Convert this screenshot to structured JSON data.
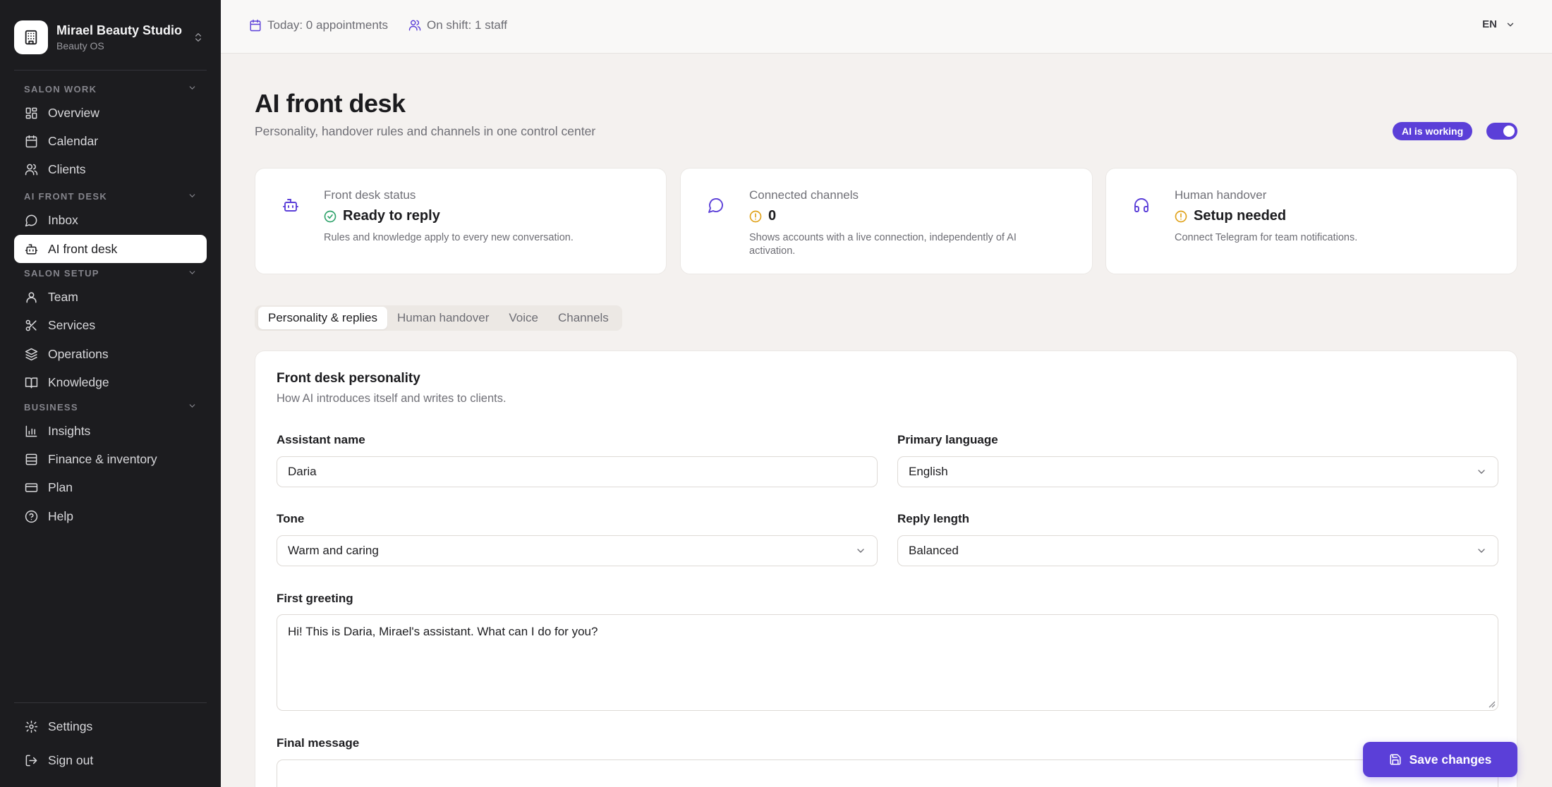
{
  "brand": {
    "name": "Mirael Beauty Studio",
    "subtitle": "Beauty OS"
  },
  "sidebar": {
    "sections": [
      {
        "title": "SALON WORK",
        "items": [
          {
            "label": "Overview",
            "icon": "grid-icon"
          },
          {
            "label": "Calendar",
            "icon": "calendar-icon"
          },
          {
            "label": "Clients",
            "icon": "users-icon"
          }
        ]
      },
      {
        "title": "AI FRONT DESK",
        "items": [
          {
            "label": "Inbox",
            "icon": "chat-bubble-icon"
          },
          {
            "label": "AI front desk",
            "icon": "robot-icon",
            "active": true
          }
        ]
      },
      {
        "title": "SALON SETUP",
        "items": [
          {
            "label": "Team",
            "icon": "user-icon"
          },
          {
            "label": "Services",
            "icon": "scissors-icon"
          },
          {
            "label": "Operations",
            "icon": "layers-icon"
          },
          {
            "label": "Knowledge",
            "icon": "book-icon"
          }
        ]
      },
      {
        "title": "BUSINESS",
        "items": [
          {
            "label": "Insights",
            "icon": "bar-chart-icon"
          },
          {
            "label": "Finance & inventory",
            "icon": "database-icon"
          },
          {
            "label": "Plan",
            "icon": "credit-card-icon"
          },
          {
            "label": "Help",
            "icon": "help-circle-icon"
          }
        ]
      }
    ],
    "footer": {
      "settings": "Settings",
      "sign_out": "Sign out"
    }
  },
  "topbar": {
    "today": "Today: 0 appointments",
    "on_shift": "On shift: 1 staff",
    "language": "EN"
  },
  "page": {
    "title": "AI front desk",
    "subtitle": "Personality, handover rules and channels in one control center",
    "ai_status_badge": "AI is working"
  },
  "cards": [
    {
      "label": "Front desk status",
      "value": "Ready to reply",
      "note": "Rules and knowledge apply to every new conversation.",
      "icon": "robot-icon",
      "status_icon": "check-circle-icon",
      "status_color": "#2fa36b"
    },
    {
      "label": "Connected channels",
      "value": "0",
      "note": "Shows accounts with a live connection, independently of AI activation.",
      "icon": "chat-bubble-icon",
      "status_icon": "alert-circle-icon",
      "status_color": "#e0a21a"
    },
    {
      "label": "Human handover",
      "value": "Setup needed",
      "note": "Connect Telegram for team notifications.",
      "icon": "headphones-icon",
      "status_icon": "alert-circle-icon",
      "status_color": "#e0a21a"
    }
  ],
  "tabs": [
    "Personality & replies",
    "Human handover",
    "Voice",
    "Channels"
  ],
  "personality": {
    "title": "Front desk personality",
    "subtitle": "How AI introduces itself and writes to clients.",
    "assistant_name_label": "Assistant name",
    "assistant_name_value": "Daria",
    "primary_language_label": "Primary language",
    "primary_language_value": "English",
    "tone_label": "Tone",
    "tone_value": "Warm and caring",
    "reply_length_label": "Reply length",
    "reply_length_value": "Balanced",
    "first_greeting_label": "First greeting",
    "first_greeting_value": "Hi! This is Daria, Mirael's assistant. What can I do for you?",
    "final_message_label": "Final message"
  },
  "actions": {
    "save": "Save changes"
  },
  "colors": {
    "accent": "#5b3fd8",
    "sidebar_bg": "#1c1c1f",
    "page_bg": "#f4f1ef"
  }
}
